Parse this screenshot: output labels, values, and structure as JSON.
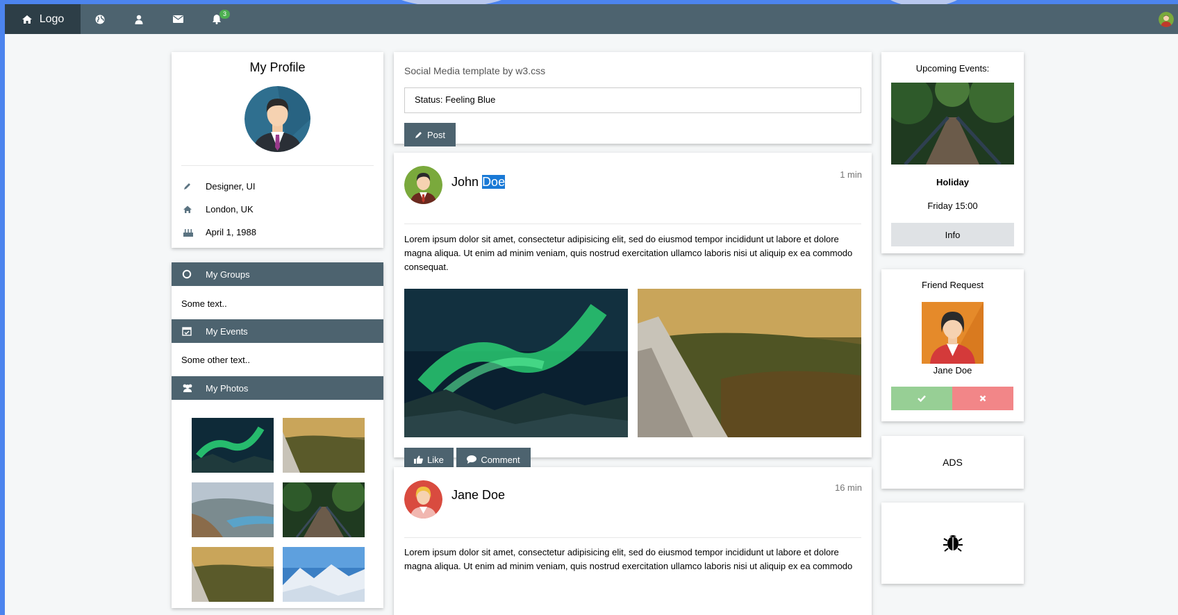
{
  "topbar": {
    "logo_label": "Logo",
    "notification_count": "3",
    "icons": [
      "home-icon",
      "globe-icon",
      "user-icon",
      "envelope-icon",
      "bell-icon"
    ]
  },
  "profile": {
    "title": "My Profile",
    "job": "Designer, UI",
    "location": "London, UK",
    "birthday": "April 1, 1988"
  },
  "accordion": {
    "groups_label": "My Groups",
    "groups_text": "Some text..",
    "events_label": "My Events",
    "events_text": "Some other text..",
    "photos_label": "My Photos"
  },
  "composer": {
    "heading": "Social Media template by w3.css",
    "status_value": "Status: Feeling Blue",
    "post_label": "Post"
  },
  "posts": [
    {
      "author_first": "John",
      "author_last": "Doe",
      "time": "1 min",
      "text": "Lorem ipsum dolor sit amet, consectetur adipisicing elit, sed do eiusmod tempor incididunt ut labore et dolore magna aliqua. Ut enim ad minim veniam, quis nostrud exercitation ullamco laboris nisi ut aliquip ex ea commodo consequat.",
      "like_label": "Like",
      "comment_label": "Comment"
    },
    {
      "author": "Jane Doe",
      "time": "16 min",
      "text": "Lorem ipsum dolor sit amet, consectetur adipisicing elit, sed do eiusmod tempor incididunt ut labore et dolore magna aliqua. Ut enim ad minim veniam, quis nostrud exercitation ullamco laboris nisi ut aliquip ex ea commodo"
    }
  ],
  "events": {
    "title": "Upcoming Events:",
    "name": "Holiday",
    "time": "Friday 15:00",
    "info_label": "Info"
  },
  "friend_request": {
    "title": "Friend Request",
    "name": "Jane Doe"
  },
  "ads": {
    "label": "ADS"
  },
  "colors": {
    "theme": "#4d636f",
    "theme_dark": "#2d3e47",
    "accept": "#97cf95",
    "decline": "#f28688",
    "badge": "#4caf50",
    "highlight": "#1979d6"
  }
}
